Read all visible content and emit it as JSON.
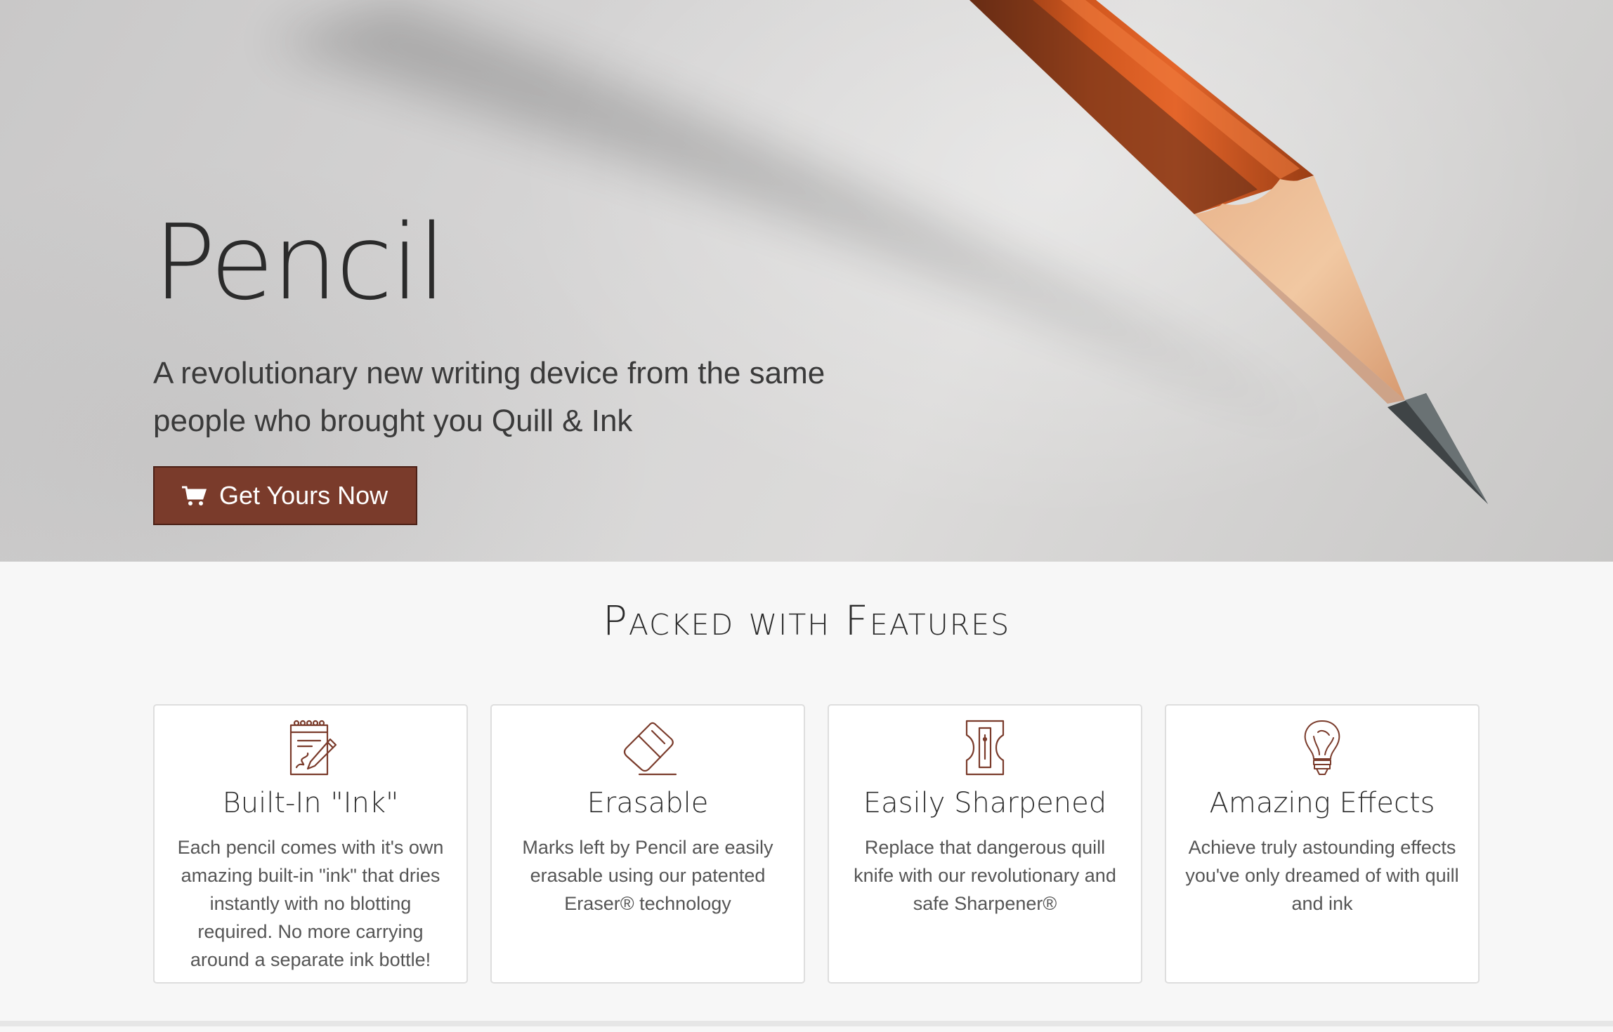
{
  "hero": {
    "title": "Pencil",
    "subtitle": "A revolutionary new writing device from the same people who brought you Quill & Ink",
    "cta_label": "Get Yours Now",
    "cta_icon": "shopping-cart-icon",
    "background_image": "pencil-on-paper"
  },
  "features": {
    "heading": "Packed with Features",
    "cards": [
      {
        "icon": "notepad-pencil-icon",
        "title": "Built-In \"Ink\"",
        "text": "Each pencil comes with it's own amazing built-in \"ink\" that dries instantly with no blotting required. No more carrying around a separate ink bottle!"
      },
      {
        "icon": "eraser-icon",
        "title": "Erasable",
        "text": "Marks left by Pencil are easily erasable using our patented Eraser® technology"
      },
      {
        "icon": "sharpener-icon",
        "title": "Easily Sharpened",
        "text": "Replace that dangerous quill knife with our revolutionary and safe Sharpener®"
      },
      {
        "icon": "lightbulb-icon",
        "title": "Amazing Effects",
        "text": "Achieve truly astounding effects you've only dreamed of with quill and ink"
      }
    ]
  },
  "colors": {
    "accent": "#7a3b2b",
    "icon_stroke": "#7a3b2b",
    "page_background": "#f7f7f7",
    "card_background": "#ffffff"
  }
}
